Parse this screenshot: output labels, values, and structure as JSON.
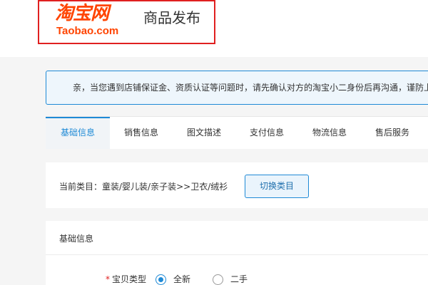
{
  "header": {
    "logo_cn": "淘宝网",
    "logo_en": "Taobao.com",
    "title": "商品发布"
  },
  "notice": {
    "text": "亲，当您遇到店铺保证金、资质认证等问题时，请先确认对方的淘宝小二身份后再沟通，谨防上"
  },
  "tabs": [
    {
      "label": "基础信息",
      "active": true
    },
    {
      "label": "销售信息"
    },
    {
      "label": "图文描述"
    },
    {
      "label": "支付信息"
    },
    {
      "label": "物流信息"
    },
    {
      "label": "售后服务"
    }
  ],
  "category": {
    "text": "当前类目：童装/婴儿装/亲子装>>卫衣/绒衫",
    "switch_label": "切换类目"
  },
  "basic_info": {
    "section_title": "基础信息",
    "item_type": {
      "required_mark": "*",
      "label": "宝贝类型",
      "options": [
        {
          "label": "全新",
          "selected": true
        },
        {
          "label": "二手",
          "selected": false
        }
      ]
    }
  },
  "colors": {
    "brand": "#ff4400",
    "accent": "#1f8ad6",
    "logo_border": "#e02020"
  }
}
